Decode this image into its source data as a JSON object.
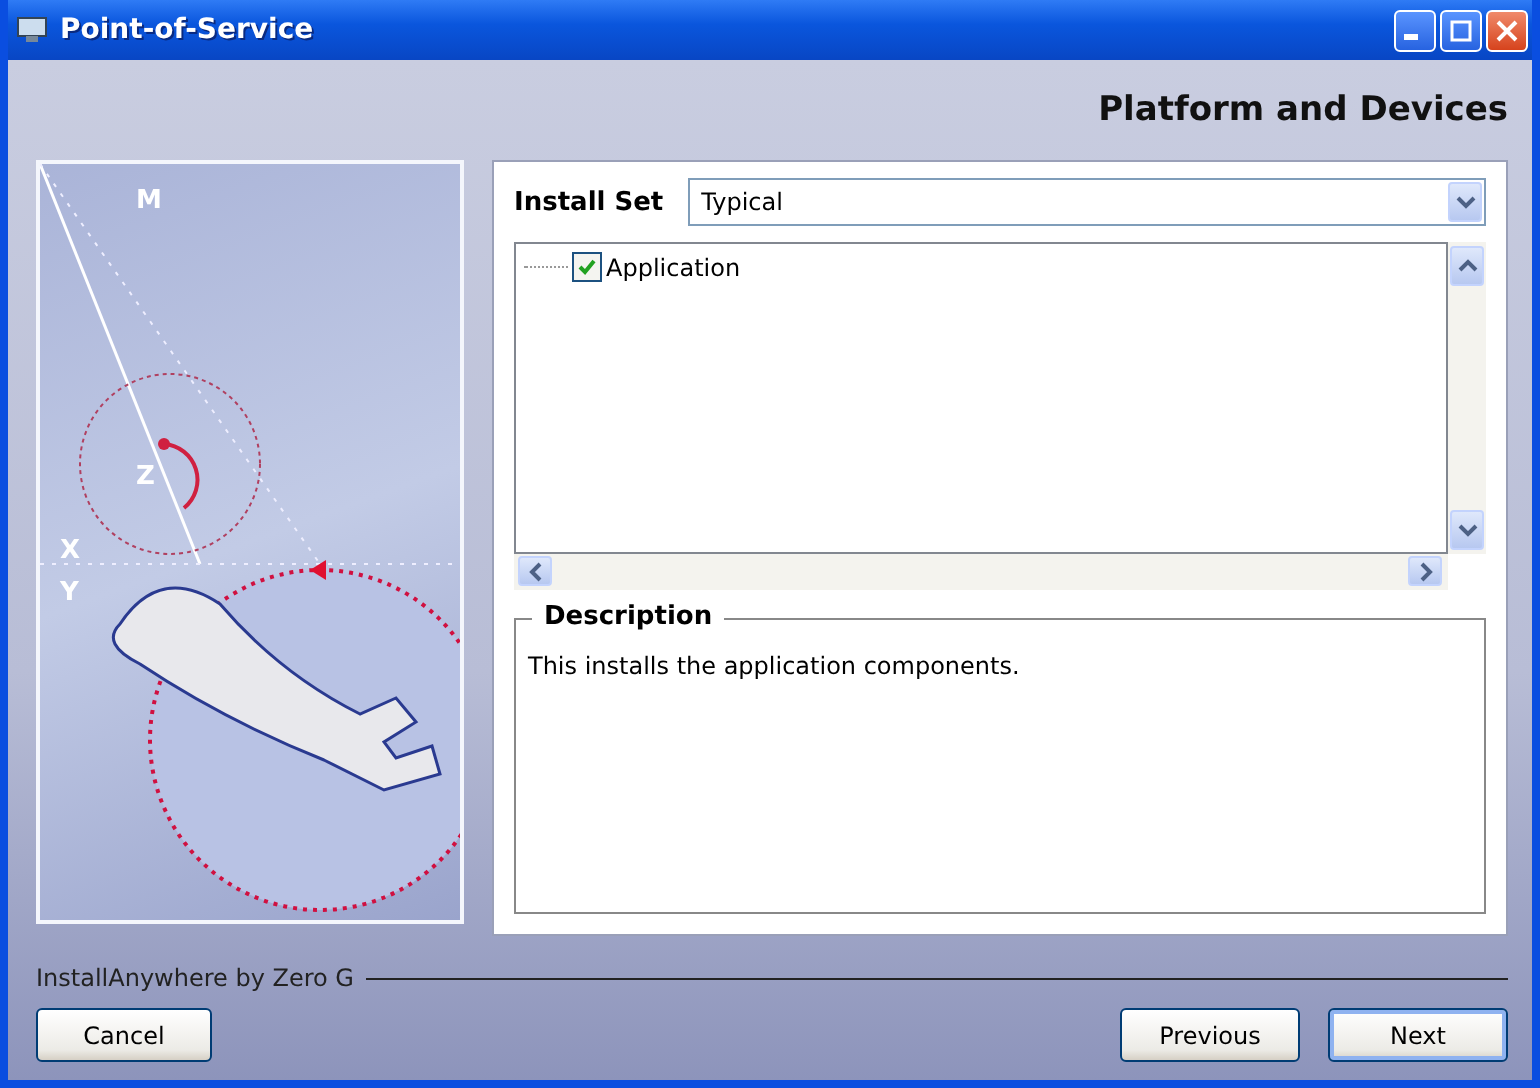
{
  "window": {
    "title": "Point-of-Service"
  },
  "header": {
    "title": "Platform and Devices"
  },
  "illustration": {
    "labels": [
      "M",
      "Z",
      "X",
      "Y"
    ]
  },
  "install_set": {
    "label": "Install Set",
    "value": "Typical"
  },
  "tree": {
    "items": [
      {
        "label": "Application",
        "checked": true
      }
    ]
  },
  "description": {
    "title": "Description",
    "text": "This installs the application components."
  },
  "footer": {
    "brand": "InstallAnywhere by Zero G"
  },
  "buttons": [
    {
      "label": "Cancel",
      "kind": "left",
      "default": false
    },
    {
      "label": "Previous",
      "kind": "right",
      "default": false
    },
    {
      "label": "Next",
      "kind": "right",
      "default": true
    }
  ]
}
